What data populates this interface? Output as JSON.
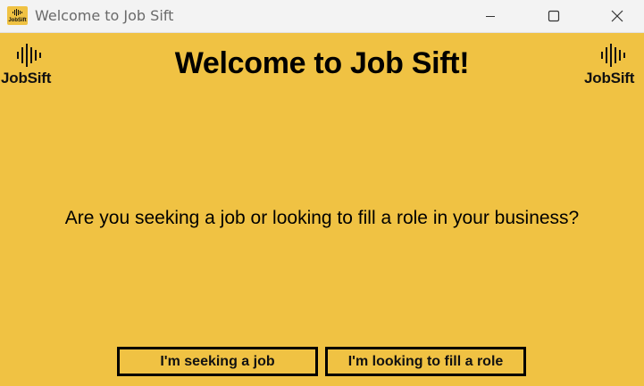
{
  "window": {
    "title": "Welcome to Job Sift",
    "icon": "jobsift-app-icon",
    "icon_text": "JobSift",
    "controls": [
      "minimize-icon",
      "maximize-icon",
      "close-icon"
    ]
  },
  "logo": {
    "text": "JobSift",
    "icon": "soundwave-bars-icon"
  },
  "main": {
    "heading": "Welcome to Job Sift!",
    "question": "Are you seeking a job or looking to fill a role in your business?"
  },
  "buttons": {
    "seek_label": "I'm seeking a job",
    "fill_label": "I'm looking to fill a role"
  },
  "colors": {
    "background": "#f0c243",
    "text": "#000000",
    "titlebar": "#f3f3f3"
  }
}
